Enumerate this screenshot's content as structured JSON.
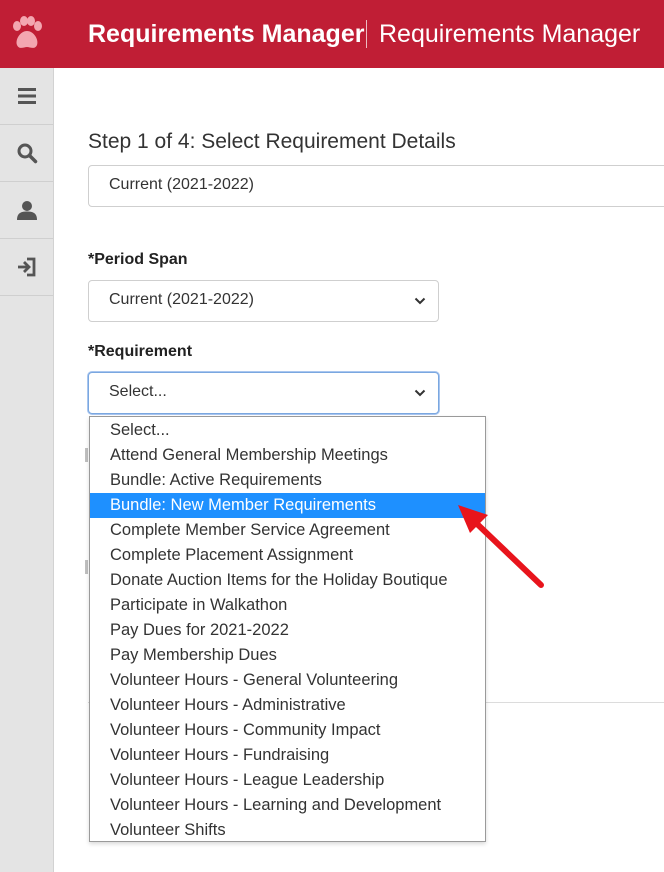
{
  "header": {
    "app_title": "Requirements Manager",
    "page_title": "Requirements Manager",
    "brand_color": "#c01e35"
  },
  "sidebar": {
    "items": [
      {
        "icon": "menu-icon"
      },
      {
        "icon": "search-icon"
      },
      {
        "icon": "user-icon"
      },
      {
        "icon": "sign-in-icon"
      }
    ]
  },
  "main": {
    "step_heading": "Step 1 of 4: Select Requirement Details",
    "context_value": "Current (2021-2022)",
    "period_span": {
      "label": "*Period Span",
      "value": "Current (2021-2022)"
    },
    "requirement": {
      "label": "*Requirement",
      "value": "Select...",
      "options": [
        "Select...",
        "Attend General Membership Meetings",
        "Bundle: Active Requirements",
        "Bundle: New Member Requirements",
        "Complete Member Service Agreement",
        "Complete Placement Assignment",
        "Donate Auction Items for the Holiday Boutique",
        "Participate in Walkathon",
        "Pay Dues for 2021-2022",
        "Pay Membership Dues",
        "Volunteer Hours - General Volunteering",
        "Volunteer Hours - Administrative",
        "Volunteer Hours - Community Impact",
        "Volunteer Hours - Fundraising",
        "Volunteer Hours - League Leadership",
        "Volunteer Hours - Learning and Development",
        "Volunteer Shifts"
      ],
      "highlighted_option": "Bundle: New Member Requirements",
      "highlight_color": "#1e90ff"
    }
  },
  "annotation": {
    "arrow_color": "#e8141c"
  }
}
